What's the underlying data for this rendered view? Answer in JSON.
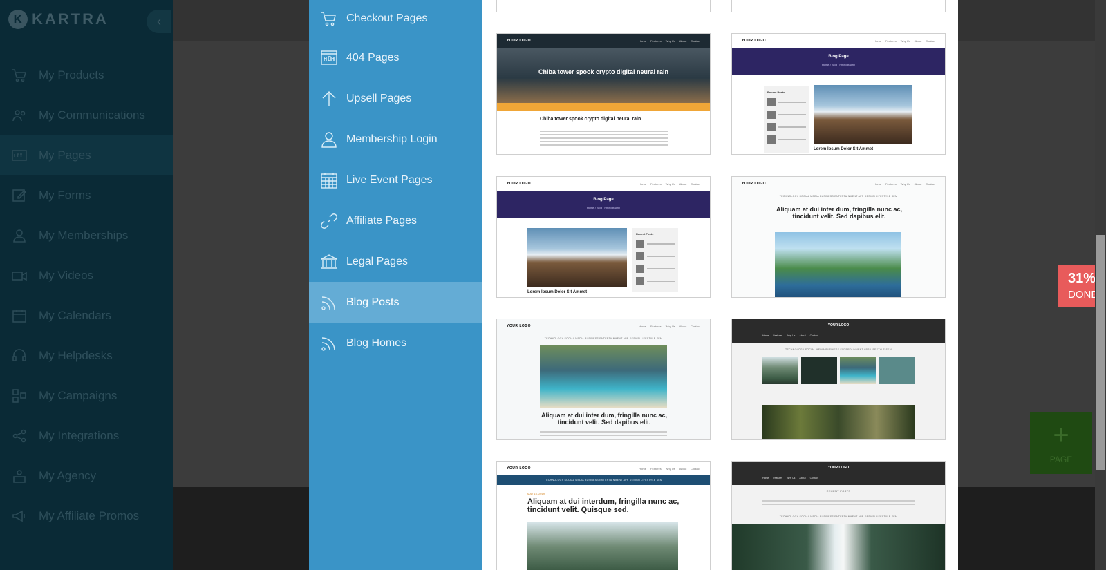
{
  "app": {
    "brand": "KARTRA",
    "collapse_glyph": "‹",
    "nav": [
      {
        "label": "My Products",
        "icon": "cart-icon"
      },
      {
        "label": "My Communications",
        "icon": "people-icon"
      },
      {
        "label": "My Pages",
        "icon": "http-icon",
        "active": true
      },
      {
        "label": "My Forms",
        "icon": "edit-icon"
      },
      {
        "label": "My Memberships",
        "icon": "membership-icon"
      },
      {
        "label": "My Videos",
        "icon": "video-icon"
      },
      {
        "label": "My Calendars",
        "icon": "calendar-icon"
      },
      {
        "label": "My Helpdesks",
        "icon": "headset-icon"
      },
      {
        "label": "My Campaigns",
        "icon": "campaign-icon"
      },
      {
        "label": "My Integrations",
        "icon": "share-icon"
      },
      {
        "label": "My Agency",
        "icon": "agency-icon"
      },
      {
        "label": "My Affiliate Promos",
        "icon": "megaphone-icon"
      }
    ],
    "progress": {
      "percent": "31%",
      "label": "DONE"
    },
    "add_page": {
      "glyph": "+",
      "label": "PAGE"
    }
  },
  "modal": {
    "categories": [
      {
        "label": "Checkout Pages",
        "icon": "cart-icon"
      },
      {
        "label": "404 Pages",
        "icon": "error-page-icon"
      },
      {
        "label": "Upsell Pages",
        "icon": "arrow-up-icon"
      },
      {
        "label": "Membership Login",
        "icon": "user-icon"
      },
      {
        "label": "Live Event Pages",
        "icon": "calendar-icon"
      },
      {
        "label": "Affiliate Pages",
        "icon": "link-icon"
      },
      {
        "label": "Legal Pages",
        "icon": "bank-icon"
      },
      {
        "label": "Blog Posts",
        "icon": "rss-icon",
        "active": true
      },
      {
        "label": "Blog Homes",
        "icon": "rss-icon"
      }
    ],
    "templates": {
      "logo": "YOUR LOGO",
      "nav_links": [
        "Home",
        "Features",
        "Why Us",
        "About",
        "Contact"
      ],
      "t1": {
        "hero": "Chiba tower spook crypto digital neural rain",
        "title": "Chiba tower spook crypto digital neural rain"
      },
      "t2": {
        "banner": "Blog Page",
        "sub": "Home / Blog / Photography",
        "side_title": "Recent Posts",
        "caption": "Lorem Ipsum Dolor Sit Ammet"
      },
      "t3": {
        "banner": "Blog Page",
        "sub": "Home / Blog / Photography",
        "side_title": "Recent Posts",
        "caption": "Lorem Ipsum Dolor Sit Ammet"
      },
      "t4": {
        "cats": "TECHNOLOGY  SOCIAL MEDIA  BUSINESS  ENTERTAINMENT  APP  DESIGN  LIFESTYLE  SEM",
        "title": "Aliquam at dui inter dum, fringilla nunc ac, tincidunt velit. Sed dapibus elit."
      },
      "t5": {
        "cats": "TECHNOLOGY  SOCIAL MEDIA  BUSINESS  ENTERTAINMENT  APP  DESIGN  LIFESTYLE  SEM",
        "title": "Aliquam at dui inter dum, fringilla nunc ac, tincidunt velit. Sed dapibus elit."
      },
      "t6": {
        "cats": "TECHNOLOGY  SOCIAL MEDIA  BUSINESS  ENTERTAINMENT  APP  LIFESTYLE  SEM"
      },
      "t7": {
        "cats": "TECHNOLOGY  SOCIAL MEDIA  BUSINESS  ENTERTAINMENT  APP  DESIGN  LIFESTYLE  SEM",
        "date": "MAY 15, 2019",
        "title": "Aliquam at dui interdum, fringilla nunc ac, tincidunt velit. Quisque sed."
      },
      "t8": {
        "recent": "RECENT POSTS",
        "cats": "TECHNOLOGY  SOCIAL MEDIA  BUSINESS  ENTERTAINMENT  APP  DESIGN  LIFESTYLE  SEM"
      }
    }
  }
}
